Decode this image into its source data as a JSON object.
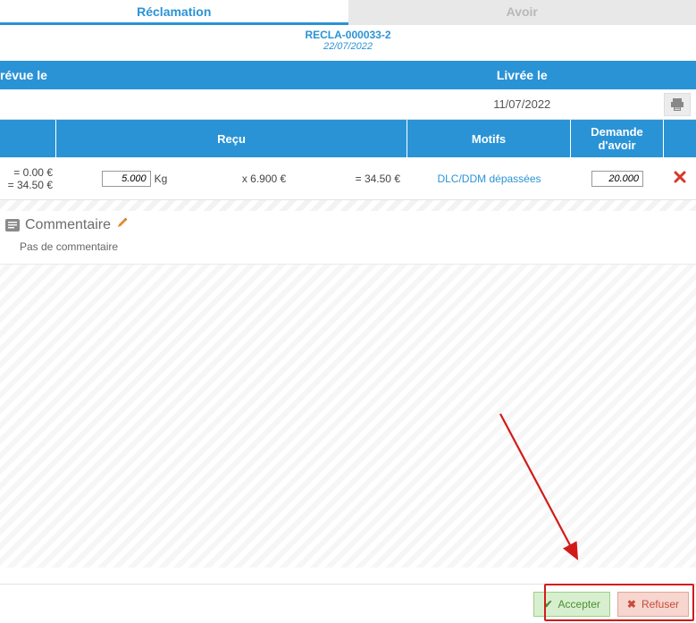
{
  "tabs": {
    "reclamation": "Réclamation",
    "avoir": "Avoir"
  },
  "sub": {
    "ref": "RECLA-000033-2",
    "date": "22/07/2022"
  },
  "header": {
    "prevue": "révue le",
    "livree": "Livrée le"
  },
  "delivery_date": "11/07/2022",
  "columns": {
    "recu": "Reçu",
    "motifs": "Motifs",
    "demande": "Demande d'avoir"
  },
  "row": {
    "amount1": "= 0.00 €",
    "amount2": "= 34.50 €",
    "qty": "5.000",
    "unit": "Kg",
    "price": "x 6.900 €",
    "total": "= 34.50 €",
    "motif": "DLC/DDM dépassées",
    "demande": "20.000"
  },
  "comment": {
    "title": "Commentaire",
    "body": "Pas de commentaire"
  },
  "buttons": {
    "accept": "Accepter",
    "refuse": "Refuser"
  }
}
